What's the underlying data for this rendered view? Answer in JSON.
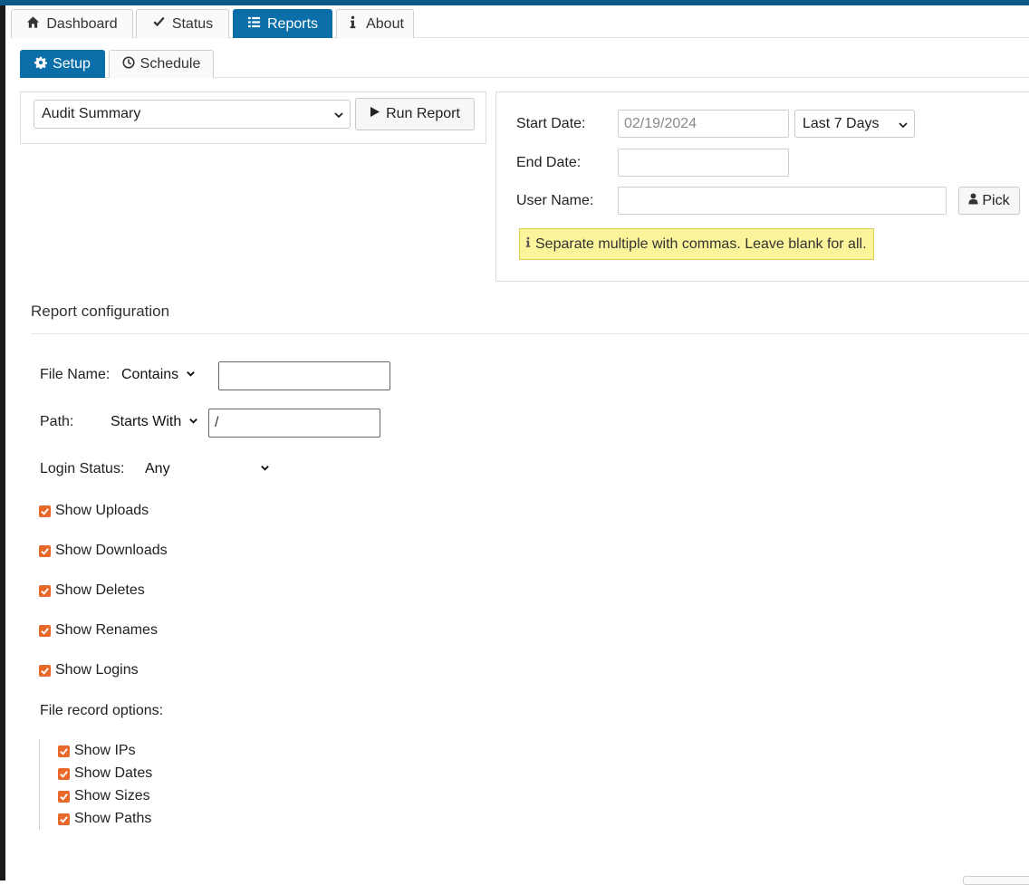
{
  "header": {
    "session_info": ""
  },
  "main_tabs": [
    {
      "label": "Dashboard",
      "icon": "home-icon"
    },
    {
      "label": "Status",
      "icon": "check-icon"
    },
    {
      "label": "Reports",
      "icon": "list-icon",
      "active": true
    },
    {
      "label": "About",
      "icon": "info-icon"
    }
  ],
  "sub_tabs": [
    {
      "label": "Setup",
      "icon": "gear-icon",
      "active": true
    },
    {
      "label": "Schedule",
      "icon": "clock-icon"
    }
  ],
  "report": {
    "selected": "Audit Summary",
    "run_label": "Run Report"
  },
  "dates": {
    "start_label": "Start Date:",
    "start_value": "02/19/2024",
    "range_selected": "Last 7 Days",
    "end_label": "End Date:",
    "end_value": "",
    "user_label": "User Name:",
    "user_value": "",
    "pick_label": "Pick",
    "hint": "Separate multiple with commas. Leave blank for all."
  },
  "config": {
    "title": "Report configuration",
    "file_name_label": "File Name:",
    "file_name_mode": "Contains",
    "file_name_value": "",
    "path_label": "Path:",
    "path_mode": "Starts With",
    "path_value": "/",
    "login_status_label": "Login Status:",
    "login_status_value": "Any",
    "checkboxes": [
      {
        "label": "Show Uploads",
        "checked": true
      },
      {
        "label": "Show Downloads",
        "checked": true
      },
      {
        "label": "Show Deletes",
        "checked": true
      },
      {
        "label": "Show Renames",
        "checked": true
      },
      {
        "label": "Show Logins",
        "checked": true
      }
    ],
    "file_record_label": "File record options:",
    "file_record_options": [
      {
        "label": "Show IPs",
        "checked": true
      },
      {
        "label": "Show Dates",
        "checked": true
      },
      {
        "label": "Show Sizes",
        "checked": true
      },
      {
        "label": "Show Paths",
        "checked": true
      }
    ]
  },
  "colors": {
    "primary": "#0a6ea8",
    "checkbox": "#e8682a",
    "hint_bg": "#fbf49a"
  }
}
